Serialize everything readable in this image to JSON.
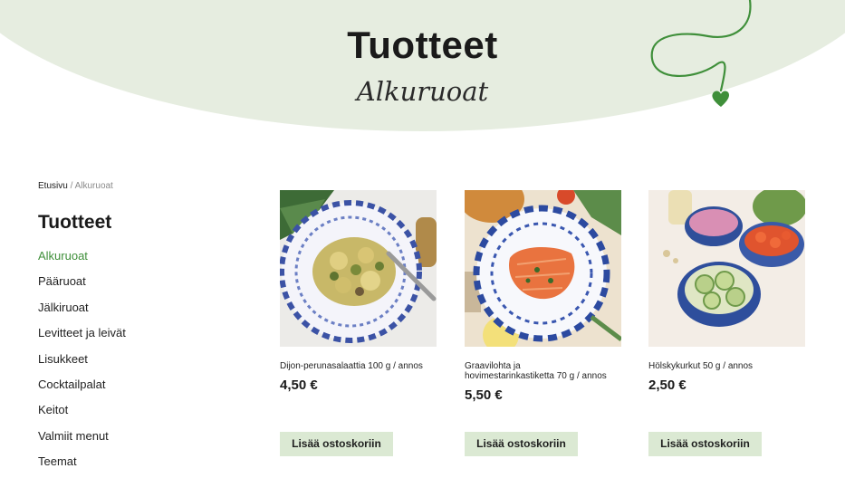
{
  "hero": {
    "title": "Tuotteet",
    "subtitle": "Alkuruoat"
  },
  "breadcrumb": {
    "home": "Etusivu",
    "separator": "/",
    "current": "Alkuruoat"
  },
  "sidebar": {
    "title": "Tuotteet",
    "items": [
      {
        "label": "Alkuruoat",
        "active": true
      },
      {
        "label": "Pääruoat"
      },
      {
        "label": "Jälkiruoat"
      },
      {
        "label": "Levitteet ja leivät"
      },
      {
        "label": "Lisukkeet"
      },
      {
        "label": "Cocktailpalat"
      },
      {
        "label": "Keitot"
      },
      {
        "label": "Valmiit menut"
      },
      {
        "label": "Teemat"
      }
    ]
  },
  "products": [
    {
      "name": "Dijon-perunasalaattia 100 g / annos",
      "price": "4,50 €",
      "button": "Lisää ostoskoriin",
      "image_icon": "potato-salad-plate-photo"
    },
    {
      "name": "Graavilohta ja hovimestarinkastiketta 70 g / annos",
      "price": "5,50 €",
      "button": "Lisää ostoskoriin",
      "image_icon": "cured-salmon-plate-photo"
    },
    {
      "name": "Hölskykurkut 50 g / annos",
      "price": "2,50 €",
      "button": "Lisää ostoskoriin",
      "image_icon": "pickled-cucumber-bowls-photo"
    }
  ],
  "colors": {
    "accent_green": "#3f8f3a",
    "hero_bg": "#e6ede0",
    "button_bg": "#dbe9d3"
  }
}
